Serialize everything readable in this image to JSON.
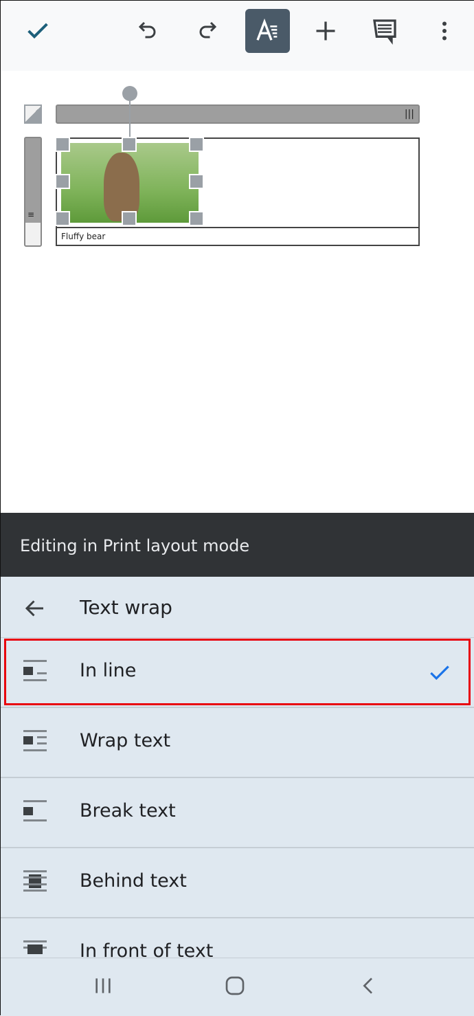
{
  "toolbar": {
    "icons": [
      "check-icon",
      "undo-icon",
      "redo-icon",
      "text-format-icon",
      "add-icon",
      "comment-icon",
      "more-vert-icon"
    ],
    "accent": "#1a73e8"
  },
  "document": {
    "caption": "Fluffy bear"
  },
  "banner": {
    "text": "Editing in Print layout mode"
  },
  "panel": {
    "title": "Text wrap",
    "options": [
      {
        "label": "In line",
        "selected": true
      },
      {
        "label": "Wrap text",
        "selected": false
      },
      {
        "label": "Break text",
        "selected": false
      },
      {
        "label": "Behind text",
        "selected": false
      },
      {
        "label": "In front of text",
        "selected": false
      }
    ]
  },
  "colors": {
    "highlight": "#e8000c",
    "check": "#1a73e8",
    "banner": "#303336",
    "panel": "#dfe8f0"
  }
}
